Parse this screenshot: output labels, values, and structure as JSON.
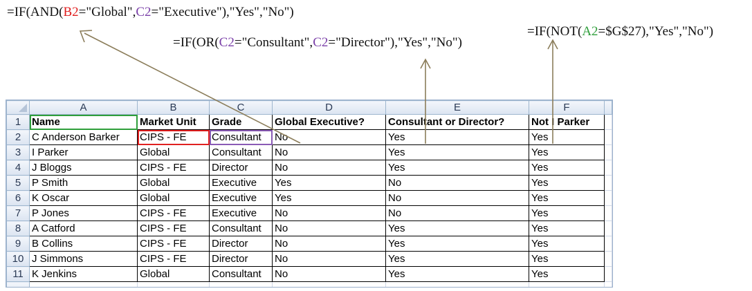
{
  "formulas": {
    "and_formula": [
      {
        "text": "=IF(AND(",
        "color": "#111111"
      },
      {
        "text": "B2",
        "color": "#e02020"
      },
      {
        "text": "=\"Global\",",
        "color": "#111111"
      },
      {
        "text": "C2",
        "color": "#7a3fa8"
      },
      {
        "text": "=\"Executive\"),\"Yes\",\"No\")",
        "color": "#111111"
      }
    ],
    "or_formula": [
      {
        "text": "=IF(OR(",
        "color": "#111111"
      },
      {
        "text": "C2",
        "color": "#7a3fa8"
      },
      {
        "text": "=\"Consultant\",",
        "color": "#111111"
      },
      {
        "text": "C2",
        "color": "#7a3fa8"
      },
      {
        "text": "=\"Director\"),\"Yes\",\"No\")",
        "color": "#111111"
      }
    ],
    "not_formula": [
      {
        "text": "=IF(NOT(",
        "color": "#111111"
      },
      {
        "text": "A2",
        "color": "#2e9e3a"
      },
      {
        "text": "=$G$27),\"Yes\",\"No\")",
        "color": "#111111"
      }
    ]
  },
  "spreadsheet": {
    "column_headers": [
      "A",
      "B",
      "C",
      "D",
      "E",
      "F"
    ],
    "header_row": {
      "row_number": "1",
      "cells": [
        "Name",
        "Market Unit",
        "Grade",
        "Global Executive?",
        "Consultant or Director?",
        "Not I Parker"
      ]
    },
    "rows": [
      {
        "row_number": "2",
        "cells": [
          "C Anderson Barker",
          "CIPS - FE",
          "Consultant",
          "No",
          "Yes",
          "Yes"
        ]
      },
      {
        "row_number": "3",
        "cells": [
          "I Parker",
          "Global",
          "Consultant",
          "No",
          "Yes",
          "Yes"
        ]
      },
      {
        "row_number": "4",
        "cells": [
          "J Bloggs",
          "CIPS - FE",
          "Director",
          "No",
          "Yes",
          "Yes"
        ]
      },
      {
        "row_number": "5",
        "cells": [
          "P Smith",
          "Global",
          "Executive",
          "Yes",
          "No",
          "Yes"
        ]
      },
      {
        "row_number": "6",
        "cells": [
          "K Oscar",
          "Global",
          "Executive",
          "Yes",
          "No",
          "Yes"
        ]
      },
      {
        "row_number": "7",
        "cells": [
          "P Jones",
          "CIPS - FE",
          "Executive",
          "No",
          "No",
          "Yes"
        ]
      },
      {
        "row_number": "8",
        "cells": [
          "A Catford",
          "CIPS - FE",
          "Consultant",
          "No",
          "Yes",
          "Yes"
        ]
      },
      {
        "row_number": "9",
        "cells": [
          "B Collins",
          "CIPS - FE",
          "Director",
          "No",
          "Yes",
          "Yes"
        ]
      },
      {
        "row_number": "10",
        "cells": [
          "J Simmons",
          "CIPS - FE",
          "Director",
          "No",
          "Yes",
          "Yes"
        ]
      },
      {
        "row_number": "11",
        "cells": [
          "K Jenkins",
          "Global",
          "Consultant",
          "No",
          "Yes",
          "Yes"
        ]
      }
    ]
  },
  "colors": {
    "arrow": "#8b7d5a",
    "highlight_name": "#2e9e3a",
    "highlight_market_unit": "#e02020",
    "highlight_grade": "#8a5bb5"
  }
}
